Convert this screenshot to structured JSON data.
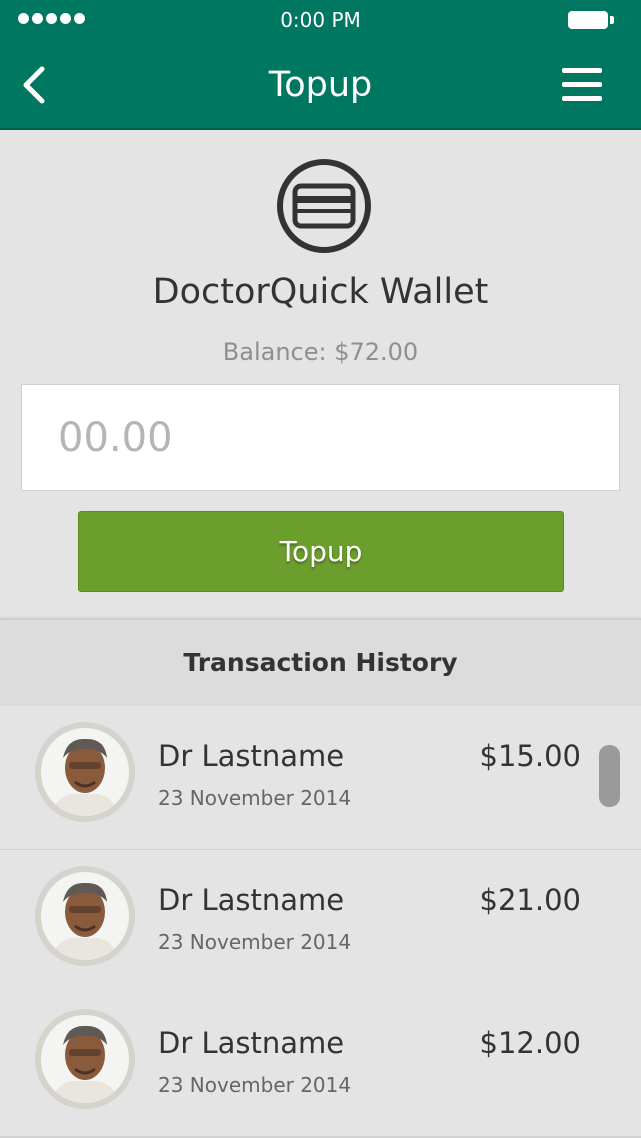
{
  "status_bar": {
    "time": "0:00 PM",
    "signal_dots": 5,
    "battery_icon": "battery-icon"
  },
  "nav": {
    "title": "Topup",
    "back_icon": "chevron-left-icon",
    "menu_icon": "hamburger-menu-icon"
  },
  "wallet": {
    "icon": "credit-card-icon",
    "title": "DoctorQuick Wallet",
    "balance": "Balance: $72.00"
  },
  "amount_input": {
    "placeholder": "00.00",
    "value": ""
  },
  "topup_button": {
    "label": "Topup"
  },
  "history": {
    "title": "Transaction History",
    "items": [
      {
        "name": "Dr Lastname",
        "date": "23 November 2014",
        "amount": "$15.00"
      },
      {
        "name": "Dr Lastname",
        "date": "23 November 2014",
        "amount": "$21.00"
      },
      {
        "name": "Dr Lastname",
        "date": "23 November 2014",
        "amount": "$12.00"
      }
    ]
  },
  "colors": {
    "header": "#007760",
    "button": "#6c9e2e",
    "background": "#e4e4e4"
  }
}
